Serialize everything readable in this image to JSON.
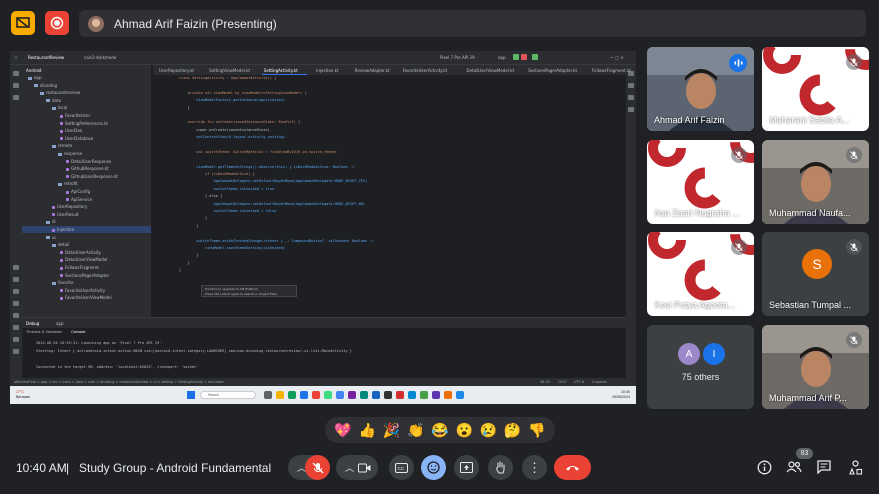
{
  "presenter": {
    "name": "Ahmad Arif Faizin (Presenting)"
  },
  "ide": {
    "project_label": "RestaurantReview",
    "branch": "calc2-darkmode",
    "device": "Pixel 7 Pro API 29",
    "run_config": "app",
    "sidebar_title": "Android",
    "tree": [
      {
        "label": "app",
        "indent": 6,
        "type": "fold"
      },
      {
        "label": "dicoding",
        "indent": 12,
        "type": "fold"
      },
      {
        "label": "restaurantreview",
        "indent": 18,
        "type": "fold"
      },
      {
        "label": "data",
        "indent": 24,
        "type": "fold"
      },
      {
        "label": "local",
        "indent": 30,
        "type": "fold"
      },
      {
        "label": "FavoriteUser",
        "indent": 38,
        "type": "kt"
      },
      {
        "label": "SettingPreferences.kt",
        "indent": 38,
        "type": "kt"
      },
      {
        "label": "UserDao",
        "indent": 38,
        "type": "kt"
      },
      {
        "label": "UserDatabase",
        "indent": 38,
        "type": "kt"
      },
      {
        "label": "remote",
        "indent": 30,
        "type": "fold"
      },
      {
        "label": "response",
        "indent": 36,
        "type": "fold"
      },
      {
        "label": "DetailUserResponse",
        "indent": 44,
        "type": "kt"
      },
      {
        "label": "GithubResponse.kt",
        "indent": 44,
        "type": "kt"
      },
      {
        "label": "GithubUserResponse.kt",
        "indent": 44,
        "type": "kt"
      },
      {
        "label": "retrofit",
        "indent": 36,
        "type": "fold"
      },
      {
        "label": "ApiConfig",
        "indent": 44,
        "type": "kt"
      },
      {
        "label": "ApiService",
        "indent": 44,
        "type": "kt"
      },
      {
        "label": "UserRepository",
        "indent": 30,
        "type": "kt"
      },
      {
        "label": "UserResult",
        "indent": 30,
        "type": "kt"
      },
      {
        "label": "di",
        "indent": 24,
        "type": "fold"
      },
      {
        "label": "Injection",
        "indent": 30,
        "type": "kt",
        "selected": true
      },
      {
        "label": "ui",
        "indent": 24,
        "type": "fold"
      },
      {
        "label": "detail",
        "indent": 30,
        "type": "fold"
      },
      {
        "label": "DetailUserActivity",
        "indent": 38,
        "type": "kt"
      },
      {
        "label": "DetailUserViewModel",
        "indent": 38,
        "type": "kt"
      },
      {
        "label": "FollowsFragment",
        "indent": 38,
        "type": "kt"
      },
      {
        "label": "SectionsPagerAdapter",
        "indent": 38,
        "type": "kt"
      },
      {
        "label": "favorite",
        "indent": 30,
        "type": "fold"
      },
      {
        "label": "FavoriteUserActivity",
        "indent": 38,
        "type": "kt"
      },
      {
        "label": "FavoriteUserViewModel",
        "indent": 38,
        "type": "kt"
      }
    ],
    "tabs": [
      "UserRepository.kt",
      "SettingViewModel.kt",
      "SettingActivity.kt",
      "Injection.kt",
      "ReviewAdapter.kt",
      "FavoriteUserActivity.kt",
      "DetailUserViewModel.kt",
      "SectionsPagerAdapter.kt",
      "FollowsFragment.kt"
    ],
    "active_tab": 2,
    "code": [
      "class SettingActivity : AppCompatActivity() {",
      "",
      "    private val viewModel by viewModels<SettingViewModel> {",
      "        ViewModelFactory.getInstance(application)",
      "    }",
      "",
      "    override fun onCreate(savedInstanceState: Bundle?) {",
      "        super.onCreate(savedInstanceState)",
      "        setContentView(R.layout.activity_setting)",
      "",
      "        val switchTheme: SwitchMaterial = findViewById(R.id.switch_theme)",
      "",
      "        viewModel.getThemeSettings().observe(this) { isDarkModeActive: Boolean ->",
      "            if (isDarkModeActive) {",
      "                AppCompatDelegate.setDefaultNightMode(AppCompatDelegate.MODE_NIGHT_YES)",
      "                switchTheme.isChecked = true",
      "            } else {",
      "                AppCompatDelegate.setDefaultNightMode(AppCompatDelegate.MODE_NIGHT_NO)",
      "                switchTheme.isChecked = false",
      "            }",
      "        }",
      "",
      "        switchTheme.setOnCheckedChangeListener { _: CompoundButton?, isChecked: Boolean ->",
      "            viewModel.saveThemeSetting(isChecked)",
      "        }",
      "    }",
      "}"
    ],
    "tooltip": [
      "It's time to upgrade to API Platform",
      "Press Ctrl+Alt+P again to search in Project Files"
    ],
    "bottom_tabs": [
      "Debug",
      "app"
    ],
    "debug_subtabs": [
      "Threads & Variables",
      "Console"
    ],
    "console": [
      "2024-06-26 10:39:31: Launching app on 'Pixel 7 Pro API 29'.",
      "Starting: Intent { act=android.intent.action.MAIN cat=[android.intent.category.LAUNCHER] cmp=com.dicoding.restaurantreview/.ui.list.MainActivity }",
      "",
      "Connected to the target VM, address: 'localhost:62833', transport: 'socket'"
    ],
    "statusbar_path": "aReviewFinal > app > src > main > java > com > dicoding > restaurantreview > ui > setting > SettingActivity > onCreate",
    "statusbar_right": [
      "38:33",
      "CRLF",
      "UTF-8",
      "4 spaces"
    ]
  },
  "taskbar": {
    "weather_temp": "27°C",
    "weather_desc": "Berawan",
    "search_placeholder": "Search",
    "time": "10:40",
    "date": "26/06/2024"
  },
  "participants": [
    {
      "name": "Ahmad Arif Faizin",
      "type": "video",
      "speaking": true
    },
    {
      "name": "Maharani Sabila A...",
      "type": "logo",
      "muted": true
    },
    {
      "name": "Asa Zaari Nugraha ...",
      "type": "logo",
      "muted": true
    },
    {
      "name": "Muhammad Naufa...",
      "type": "video",
      "muted": true
    },
    {
      "name": "Kesi Putya Agoota...",
      "type": "logo",
      "muted": true
    },
    {
      "name": "Sebastian Tumpal ...",
      "type": "initial",
      "initial": "S",
      "muted": true
    },
    {
      "name": "75 others",
      "type": "others",
      "initials": [
        "A",
        "I"
      ]
    },
    {
      "name": "Muhammad Arif P...",
      "type": "video",
      "muted": true
    }
  ],
  "reactions": [
    "💖",
    "👍",
    "🎉",
    "👏",
    "😂",
    "😮",
    "😢",
    "🤔",
    "👎"
  ],
  "meeting": {
    "time": "10:40 AM",
    "separator": "|",
    "title": "Study Group - Android Fundamental",
    "participant_count": "83"
  },
  "colors": {
    "accent": "#8ab4f8",
    "end_call": "#ea4335",
    "mic_active": "#1a73e8",
    "brand_red": "#c0282d"
  }
}
